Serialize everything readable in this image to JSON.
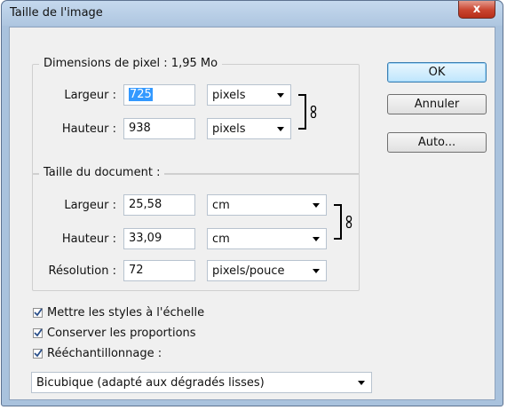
{
  "window": {
    "title": "Taille de l'image",
    "close_label": "x"
  },
  "pixel_dimensions": {
    "legend": "Dimensions de pixel : 1,95 Mo",
    "width_label": "Largeur :",
    "width_value": "725",
    "width_unit": "pixels",
    "height_label": "Hauteur :",
    "height_value": "938",
    "height_unit": "pixels"
  },
  "document_size": {
    "legend": "Taille du document :",
    "width_label": "Largeur :",
    "width_value": "25,58",
    "width_unit": "cm",
    "height_label": "Hauteur :",
    "height_value": "33,09",
    "height_unit": "cm",
    "resolution_label": "Résolution :",
    "resolution_value": "72",
    "resolution_unit": "pixels/pouce"
  },
  "buttons": {
    "ok": "OK",
    "cancel": "Annuler",
    "auto": "Auto..."
  },
  "options": {
    "scale_styles": {
      "label": "Mettre les styles à l'échelle",
      "checked": true
    },
    "constrain": {
      "label": "Conserver les proportions",
      "checked": true
    },
    "resample": {
      "label": "Rééchantillonnage :",
      "checked": true
    }
  },
  "resample_method": "Bicubique (adapté aux dégradés lisses)"
}
